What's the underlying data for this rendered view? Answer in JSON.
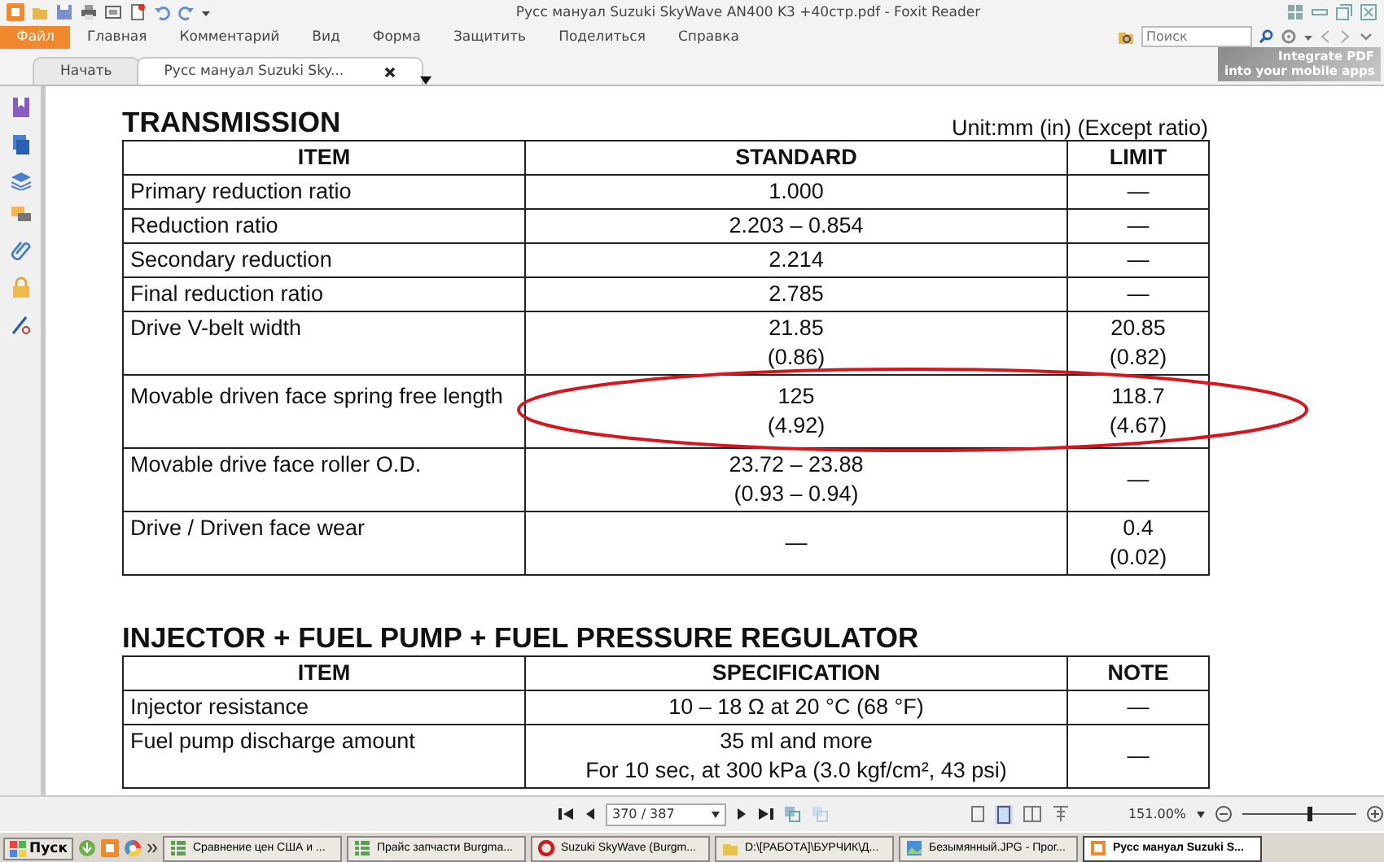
{
  "window": {
    "title": "Русс мануал Suzuki SkyWave AN400 K3 +40стр.pdf - Foxit Reader"
  },
  "menu": [
    {
      "label": "Файл",
      "selected": true
    },
    {
      "label": "Главная",
      "selected": false
    },
    {
      "label": "Комментарий",
      "selected": false
    },
    {
      "label": "Вид",
      "selected": false
    },
    {
      "label": "Форма",
      "selected": false
    },
    {
      "label": "Защитить",
      "selected": false
    },
    {
      "label": "Поделиться",
      "selected": false
    },
    {
      "label": "Справка",
      "selected": false
    }
  ],
  "search": {
    "placeholder": "Поиск"
  },
  "tabs": [
    {
      "label": "Начать",
      "selected": false
    },
    {
      "label": "Русс мануал Suzuki Sky...",
      "selected": true
    }
  ],
  "ad_banner": {
    "lines": [
      "Integrate PDF",
      "into your mobile apps"
    ]
  },
  "document": {
    "sections": [
      {
        "title": "TRANSMISSION",
        "unit": "Unit:mm (in) (Except ratio)",
        "columns": [
          "ITEM",
          "STANDARD",
          "LIMIT"
        ],
        "rows": [
          {
            "cells": [
              [
                "Primary reduction ratio"
              ],
              [
                "1.000"
              ],
              [
                "—"
              ]
            ],
            "highlighted": false
          },
          {
            "cells": [
              [
                "Reduction ratio"
              ],
              [
                "2.203 – 0.854"
              ],
              [
                "—"
              ]
            ],
            "highlighted": false
          },
          {
            "cells": [
              [
                "Secondary reduction"
              ],
              [
                "2.214"
              ],
              [
                "—"
              ]
            ],
            "highlighted": false
          },
          {
            "cells": [
              [
                "Final reduction ratio"
              ],
              [
                "2.785"
              ],
              [
                "—"
              ]
            ],
            "highlighted": false
          },
          {
            "cells": [
              [
                "Drive V-belt width"
              ],
              [
                "21.85",
                "(0.86)"
              ],
              [
                "20.85",
                "(0.82)"
              ]
            ],
            "highlighted": false
          },
          {
            "cells": [
              [
                "Movable driven face spring free length"
              ],
              [
                "125",
                "(4.92)"
              ],
              [
                "118.7",
                "(4.67)"
              ]
            ],
            "highlighted": true
          },
          {
            "cells": [
              [
                "Movable drive face roller O.D."
              ],
              [
                "23.72 – 23.88",
                "(0.93 – 0.94)"
              ],
              [
                "—"
              ]
            ],
            "highlighted": false
          },
          {
            "cells": [
              [
                "Drive / Driven face wear"
              ],
              [
                "—"
              ],
              [
                "0.4",
                "(0.02)"
              ]
            ],
            "highlighted": false
          }
        ]
      },
      {
        "title": "INJECTOR + FUEL PUMP + FUEL PRESSURE REGULATOR",
        "columns": [
          "ITEM",
          "SPECIFICATION",
          "NOTE"
        ],
        "rows": [
          {
            "cells": [
              [
                "Injector resistance"
              ],
              [
                "10 – 18  Ω at 20 °C (68 °F)"
              ],
              [
                "—"
              ]
            ],
            "highlighted": false
          },
          {
            "cells": [
              [
                "Fuel pump discharge amount"
              ],
              [
                "35 ml and more",
                "For 10 sec, at 300 kPa (3.0 kgf/cm², 43 psi)"
              ],
              [
                "—"
              ]
            ],
            "highlighted": false
          }
        ]
      }
    ]
  },
  "status_bar": {
    "page": "370 / 387",
    "zoom": "151.00%",
    "zoom_slider": {
      "level": 0.6
    }
  },
  "taskbar": {
    "start": "Пуск",
    "items": [
      {
        "label": "Сравнение цен США и ...",
        "selected": false,
        "kind": "sheet"
      },
      {
        "label": "Прайс запчасти Burgma...",
        "selected": false,
        "kind": "sheet"
      },
      {
        "label": "Suzuki SkyWave (Burgm...",
        "selected": false,
        "kind": "browser"
      },
      {
        "label": "D:\\[РАБОТА]\\БУРЧИК\\Д...",
        "selected": false,
        "kind": "folder"
      },
      {
        "label": "Безымянный.JPG - Прог...",
        "selected": false,
        "kind": "image"
      },
      {
        "label": "Русс мануал Suzuki S...",
        "selected": true,
        "kind": "pdf"
      }
    ]
  }
}
